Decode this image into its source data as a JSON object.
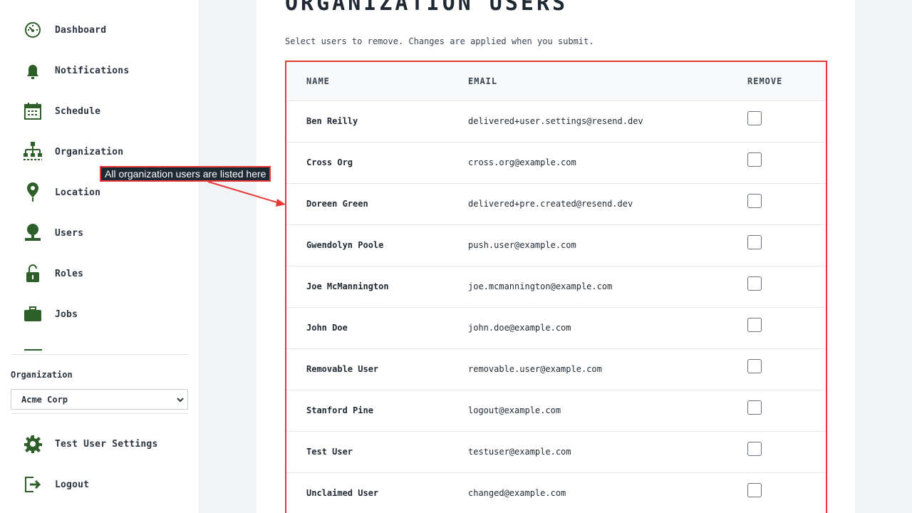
{
  "sidebar": {
    "items": [
      {
        "label": "Dashboard",
        "icon": "dashboard-icon"
      },
      {
        "label": "Notifications",
        "icon": "bell-icon"
      },
      {
        "label": "Schedule",
        "icon": "calendar-icon"
      },
      {
        "label": "Organization",
        "icon": "org-chart-icon"
      },
      {
        "label": "Location",
        "icon": "location-pin-icon"
      },
      {
        "label": "Users",
        "icon": "user-icon"
      },
      {
        "label": "Roles",
        "icon": "unlock-icon"
      },
      {
        "label": "Jobs",
        "icon": "briefcase-icon"
      }
    ],
    "org_label": "Organization",
    "org_selected": "Acme Corp",
    "bottom_items": [
      {
        "label": "Test User Settings",
        "icon": "gear-icon"
      },
      {
        "label": "Logout",
        "icon": "logout-icon"
      }
    ]
  },
  "main": {
    "title": "ORGANIZATION USERS",
    "subtitle": "Select users to remove. Changes are applied when you submit.",
    "table": {
      "headers": {
        "name": "NAME",
        "email": "EMAIL",
        "remove": "REMOVE"
      },
      "rows": [
        {
          "name": "Ben Reilly",
          "email": "delivered+user.settings@resend.dev",
          "remove": false
        },
        {
          "name": "Cross Org",
          "email": "cross.org@example.com",
          "remove": false
        },
        {
          "name": "Doreen Green",
          "email": "delivered+pre.created@resend.dev",
          "remove": false
        },
        {
          "name": "Gwendolyn Poole",
          "email": "push.user@example.com",
          "remove": false
        },
        {
          "name": "Joe McMannington",
          "email": "joe.mcmannington@example.com",
          "remove": false
        },
        {
          "name": "John Doe",
          "email": "john.doe@example.com",
          "remove": false
        },
        {
          "name": "Removable User",
          "email": "removable.user@example.com",
          "remove": false
        },
        {
          "name": "Stanford Pine",
          "email": "logout@example.com",
          "remove": false
        },
        {
          "name": "Test User",
          "email": "testuser@example.com",
          "remove": false
        },
        {
          "name": "Unclaimed User",
          "email": "changed@example.com",
          "remove": false
        }
      ]
    }
  },
  "annotation": {
    "text": "All organization users are listed here"
  },
  "colors": {
    "icon_green": "#2e5e2a",
    "highlight_red": "#e53935"
  }
}
